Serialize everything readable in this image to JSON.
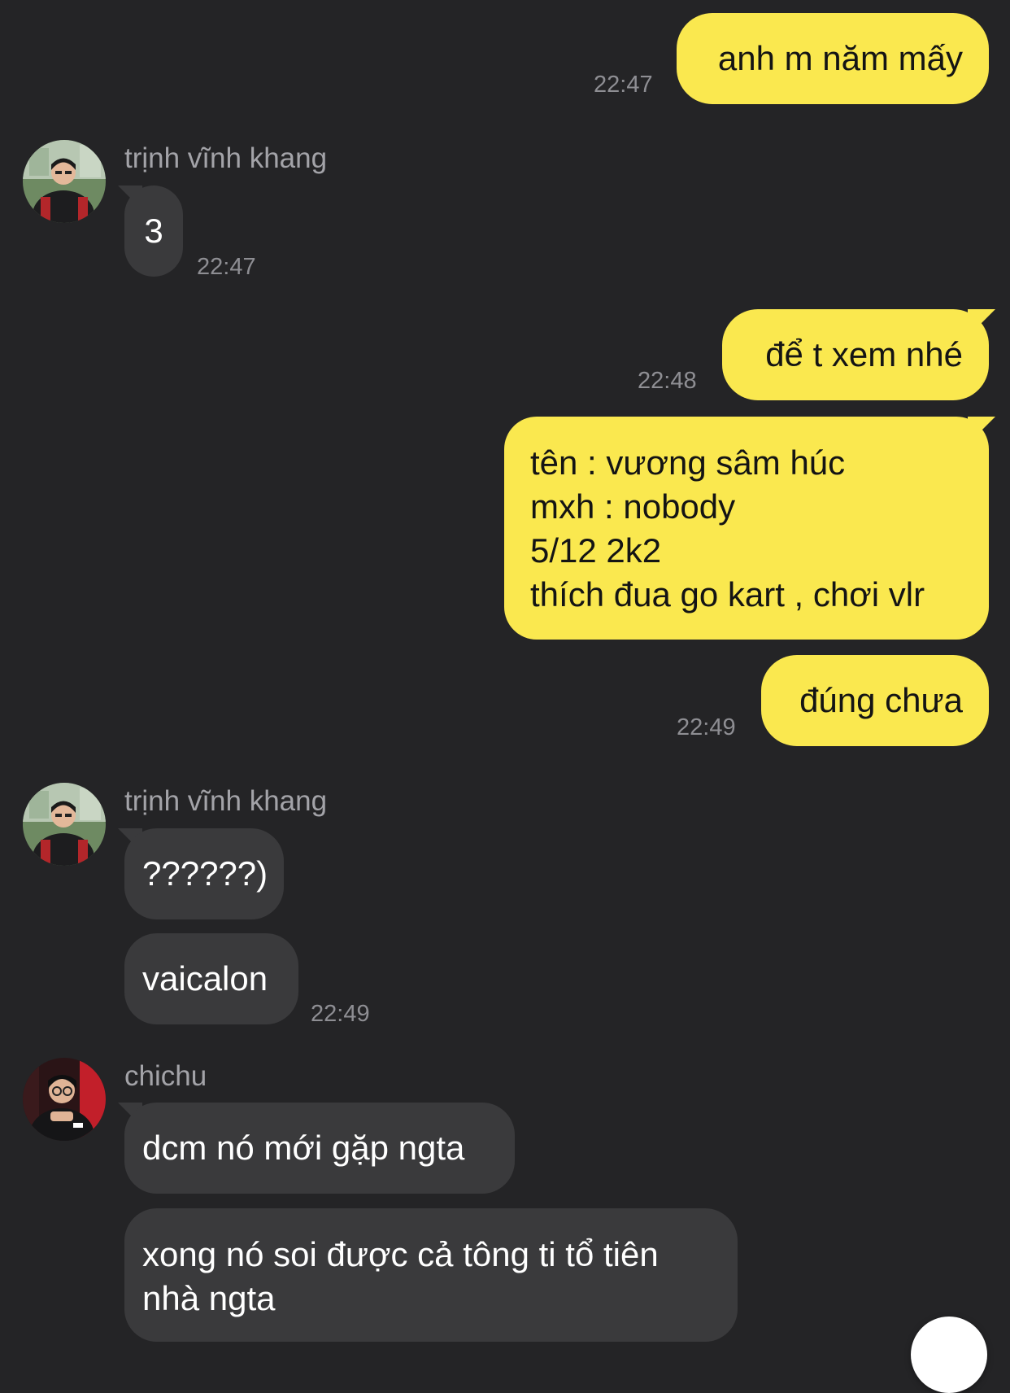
{
  "messages": [
    {
      "direction": "out",
      "text": "anh m năm mấy",
      "time": "22:47"
    },
    {
      "direction": "in",
      "sender": "trịnh vĩnh khang",
      "text": "3",
      "time": "22:47"
    },
    {
      "direction": "out",
      "text": "để t xem nhé",
      "time": "22:48"
    },
    {
      "direction": "out",
      "text": "tên : vương sâm húc\nmxh : nobody\n5/12 2k2\nthích đua go kart , chơi vlr"
    },
    {
      "direction": "out",
      "text": "đúng chưa",
      "time": "22:49"
    },
    {
      "direction": "in",
      "sender": "trịnh vĩnh khang",
      "text": "??????)"
    },
    {
      "direction": "in",
      "text": "vaicalon",
      "time": "22:49"
    },
    {
      "direction": "in",
      "sender": "chichu",
      "text": "dcm nó mới gặp ngta"
    },
    {
      "direction": "in",
      "text": "xong nó soi được cả tông ti tổ tiên\nnhà ngta"
    }
  ],
  "colors": {
    "background": "#242426",
    "outgoing_bubble": "#fae84f",
    "incoming_bubble": "#3a3a3c",
    "timestamp": "#8e8e93"
  },
  "icons": {
    "avatar_1": "user-avatar-photo",
    "avatar_2": "user-avatar-photo",
    "scroll_button": "scroll-down-button"
  }
}
